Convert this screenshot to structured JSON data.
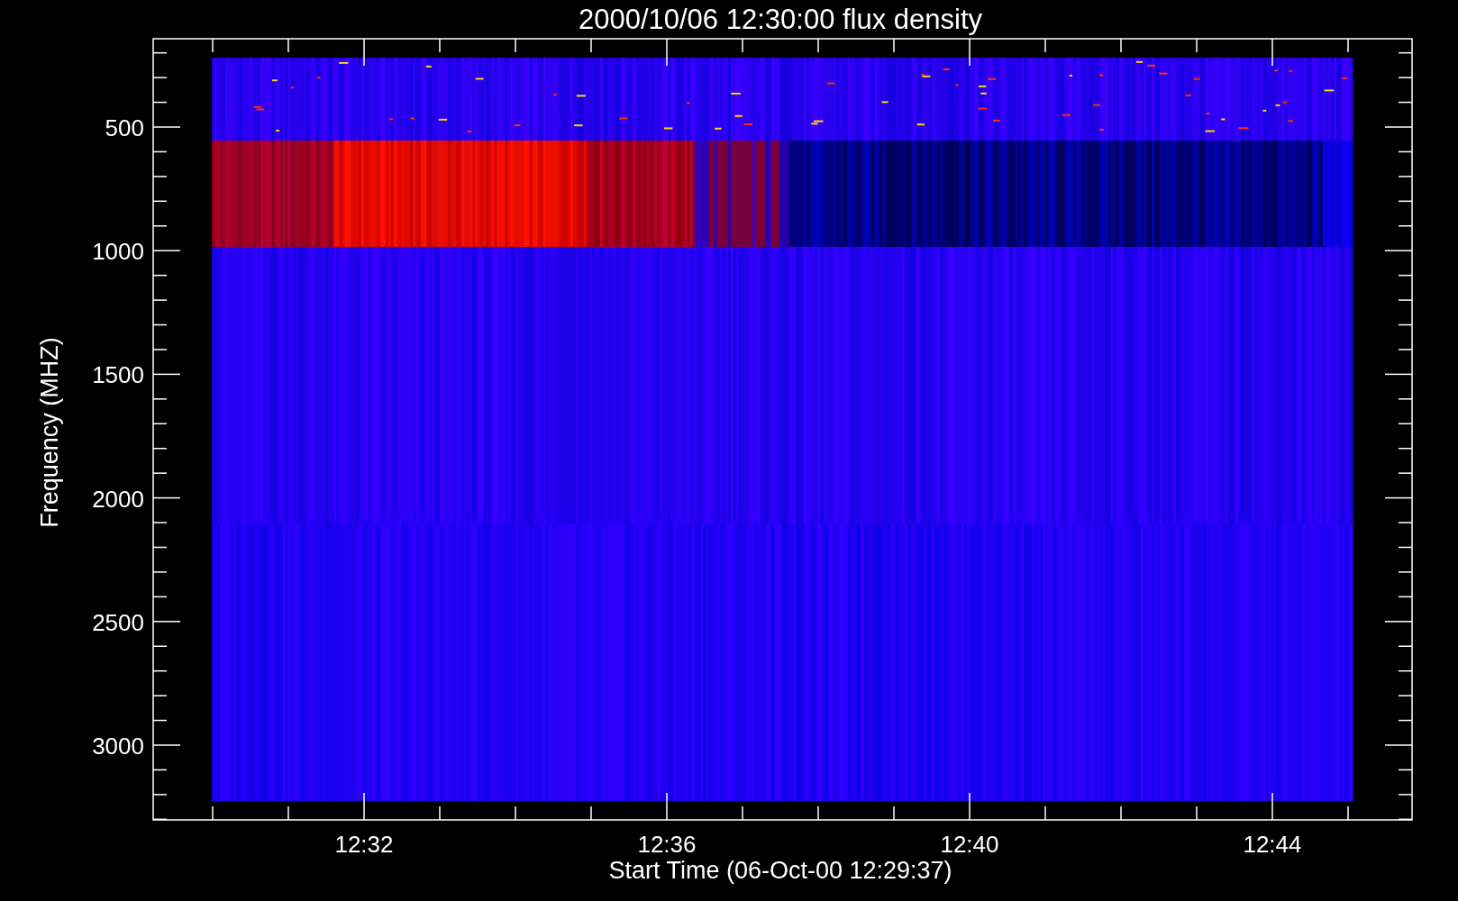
{
  "plot": {
    "title": "2000/10/06 12:30:00 flux density",
    "ylabel": "Frequency (MHZ)",
    "xlabel": "Start Time (06-Oct-00 12:29:37)",
    "yticks": [
      "500",
      "1000",
      "1500",
      "2000",
      "2500",
      "3000"
    ],
    "xticks": [
      "12:32",
      "12:36",
      "12:40",
      "12:44"
    ]
  }
}
